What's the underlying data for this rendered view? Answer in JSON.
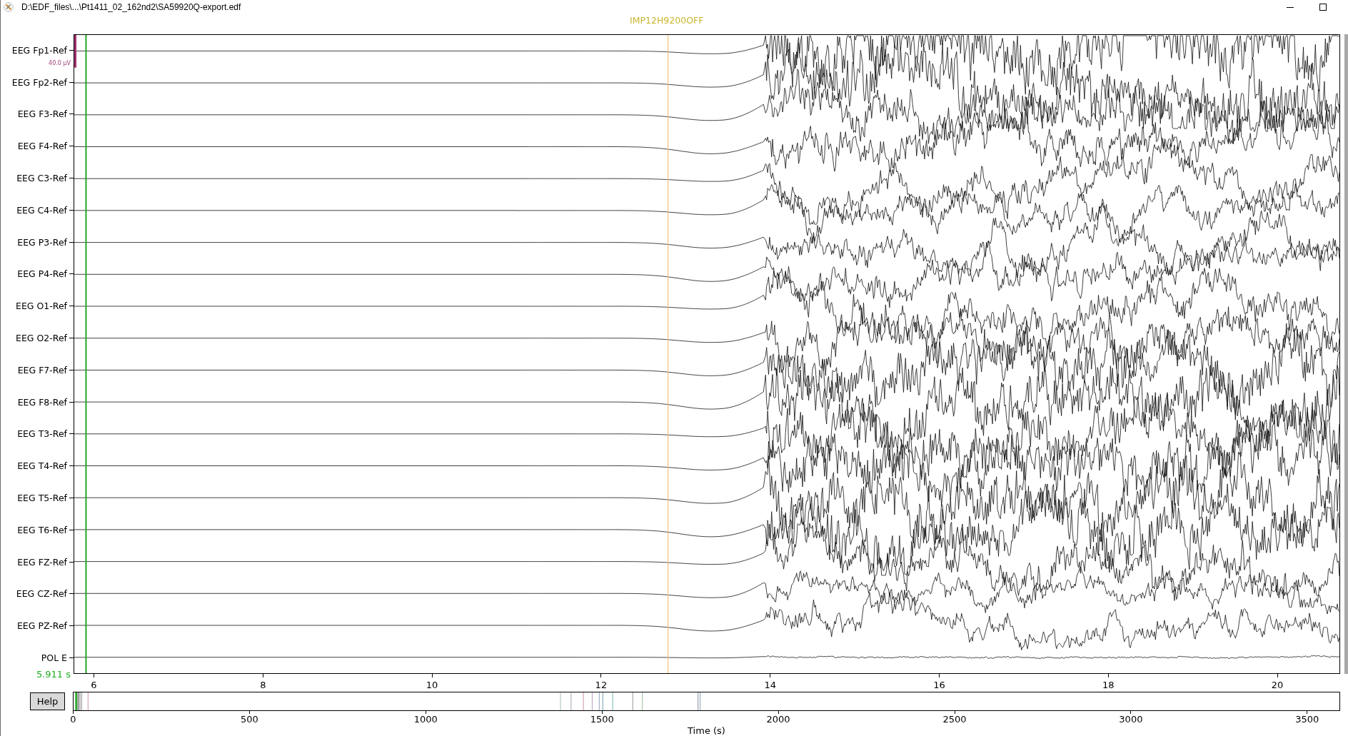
{
  "window": {
    "title": "D:\\EDF_files\\...\\Pt1411_02_162nd2\\SA59920Q-export.edf"
  },
  "annotation_label": "IMP12H9200OFF",
  "eeg_plot": {
    "channels": [
      "EEG Fp1-Ref",
      "EEG Fp2-Ref",
      "EEG F3-Ref",
      "EEG F4-Ref",
      "EEG C3-Ref",
      "EEG C4-Ref",
      "EEG P3-Ref",
      "EEG P4-Ref",
      "EEG O1-Ref",
      "EEG O2-Ref",
      "EEG F7-Ref",
      "EEG F8-Ref",
      "EEG T3-Ref",
      "EEG T4-Ref",
      "EEG T5-Ref",
      "EEG T6-Ref",
      "EEG FZ-Ref",
      "EEG CZ-Ref",
      "EEG PZ-Ref",
      "POL E"
    ],
    "scale_label": "40.0 µV",
    "cursor_time": "5.911 s",
    "x_ticks": [
      "6",
      "8",
      "10",
      "12",
      "14",
      "16",
      "18",
      "20"
    ]
  },
  "help_button": "Help",
  "overview": {
    "x_ticks": [
      "0",
      "500",
      "1000",
      "1500",
      "2000",
      "2500",
      "3000",
      "3500"
    ],
    "xlabel": "Time (s)"
  }
}
